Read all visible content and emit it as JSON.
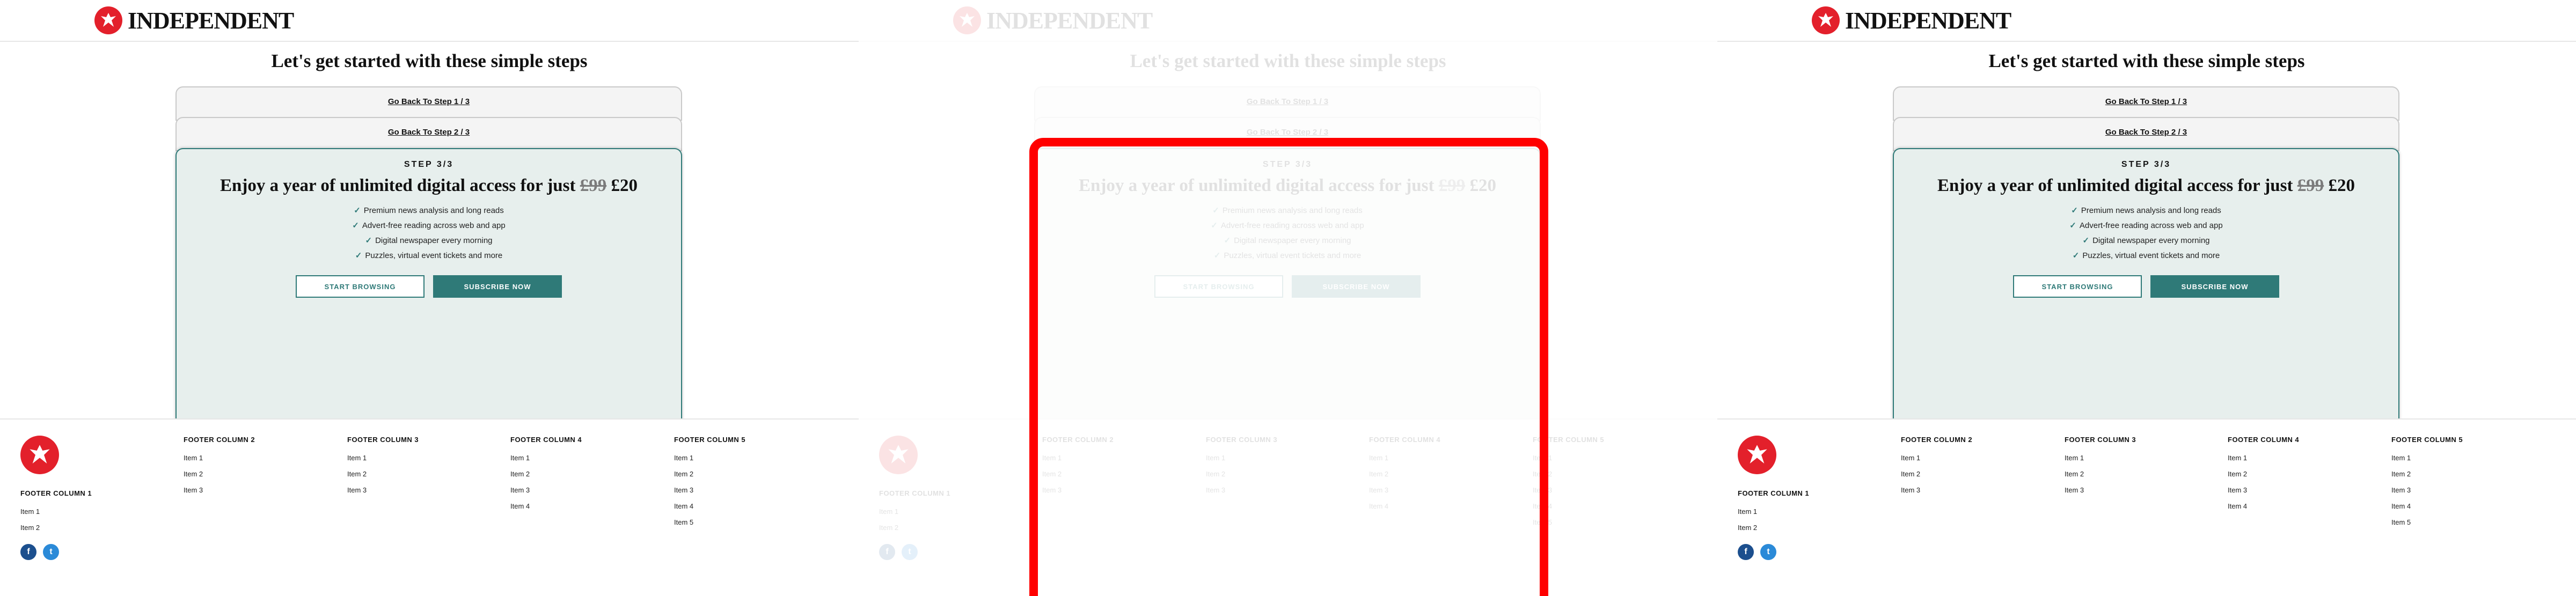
{
  "header": {
    "logo_text": "INDEPENDENT"
  },
  "page_title": "Let's get started with these simple steps",
  "steps": {
    "back1": "Go Back To Step 1 / 3",
    "back2": "Go Back To Step 2 / 3",
    "current_label": "STEP 3/3",
    "offer_prefix": "Enjoy a year of unlimited digital access for just",
    "old_price": "£99",
    "new_price": "£20",
    "features": [
      "Premium news analysis and long reads",
      "Advert-free reading across web and app",
      "Digital newspaper every morning",
      "Puzzles, virtual event tickets and more"
    ],
    "cta_secondary": "START BROWSING",
    "cta_primary": "SUBSCRIBE NOW"
  },
  "footer": {
    "columns": [
      {
        "title": "FOOTER COLUMN 1",
        "items": [
          "Item 1",
          "Item 2"
        ]
      },
      {
        "title": "FOOTER COLUMN 2",
        "items": [
          "Item 1",
          "Item 2",
          "Item 3"
        ]
      },
      {
        "title": "FOOTER COLUMN 3",
        "items": [
          "Item 1",
          "Item 2",
          "Item 3"
        ]
      },
      {
        "title": "FOOTER COLUMN 4",
        "items": [
          "Item 1",
          "Item 2",
          "Item 3",
          "Item 4"
        ]
      },
      {
        "title": "FOOTER COLUMN 5",
        "items": [
          "Item 1",
          "Item 2",
          "Item 3",
          "Item 4",
          "Item 5"
        ]
      }
    ],
    "social": [
      {
        "name": "facebook-icon",
        "glyph": "f"
      },
      {
        "name": "twitter-icon",
        "glyph": "t"
      }
    ]
  },
  "colors": {
    "brand_red": "#e3202b",
    "accent_teal": "#2f7a78",
    "card_bg": "#e7efed",
    "highlight": "#ff0000"
  }
}
